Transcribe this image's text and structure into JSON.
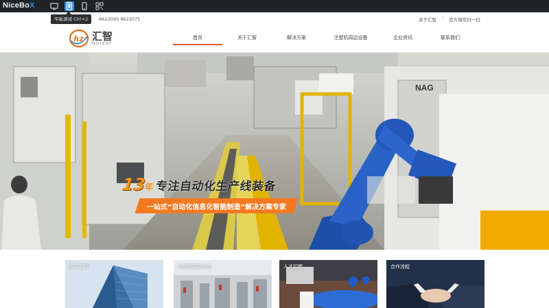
{
  "toolbar": {
    "brand_main": "NiceBo",
    "brand_x": "X",
    "tooltip": "平板测试 Ctrl+2",
    "icons": [
      "monitor-icon",
      "tablet-icon",
      "phone-icon",
      "qr-code-icon"
    ]
  },
  "header": {
    "phone": "-8622095  8622075",
    "links": [
      "关于汇智",
      "官方微信扫一扫"
    ],
    "logo_cn": "汇智",
    "logo_en": "HUIZHI"
  },
  "nav": {
    "items": [
      "首页",
      "关于汇智",
      "解决方案",
      "注塑机周边设备",
      "企业资讯",
      "联系我们"
    ],
    "active_index": 0,
    "accent_color": "#e45a14"
  },
  "banner": {
    "headline_num": "13",
    "headline_year": "年",
    "headline_text": "专注自动化生产线装备",
    "subline": "一站式“自动化信息化智能制造”解决方案专家",
    "accent_color": "#f47920",
    "robot_label": "NAG"
  },
  "cards": [
    {
      "label": "关于汇智"
    },
    {
      "label": "注塑机周边设备"
    },
    {
      "label": "人才招聘"
    },
    {
      "label": "合作流程"
    }
  ]
}
